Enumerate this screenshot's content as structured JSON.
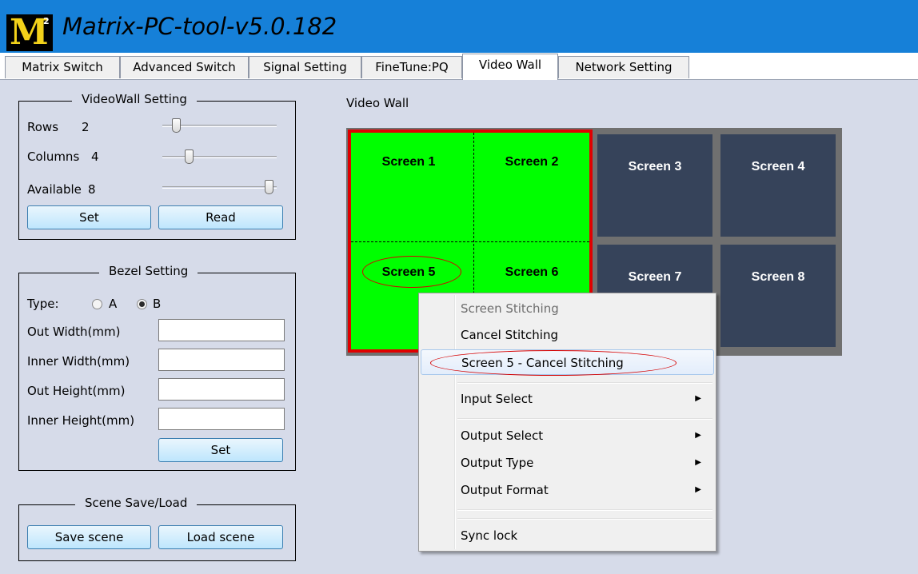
{
  "app": {
    "title": "Matrix-PC-tool-v5.0.182",
    "logo_text": "M",
    "logo_sup": "2"
  },
  "tabs": [
    {
      "label": "Matrix Switch"
    },
    {
      "label": "Advanced Switch"
    },
    {
      "label": "Signal Setting"
    },
    {
      "label": "FineTune:PQ"
    },
    {
      "label": "Video Wall"
    },
    {
      "label": "Network Setting"
    }
  ],
  "active_tab": "Video Wall",
  "videowall_setting": {
    "title": "VideoWall Setting",
    "rows_label": "Rows",
    "rows_value": "2",
    "columns_label": "Columns",
    "columns_value": "4",
    "available_label": "Available",
    "available_value": "8",
    "set_label": "Set",
    "read_label": "Read"
  },
  "bezel_setting": {
    "title": "Bezel Setting",
    "type_label": "Type:",
    "option_a": "A",
    "option_b": "B",
    "selected": "B",
    "out_width_label": "Out Width(mm)",
    "inner_width_label": "Inner Width(mm)",
    "out_height_label": "Out Height(mm)",
    "inner_height_label": "Inner Height(mm)",
    "out_width_value": "",
    "inner_width_value": "",
    "out_height_value": "",
    "inner_height_value": "",
    "set_label": "Set"
  },
  "scene": {
    "title": "Scene Save/Load",
    "save_label": "Save scene",
    "load_label": "Load scene"
  },
  "video_wall": {
    "title": "Video Wall",
    "screens": [
      "Screen 1",
      "Screen 2",
      "Screen 3",
      "Screen 4",
      "Screen 5",
      "Screen 6",
      "Screen 7",
      "Screen 8"
    ],
    "merged_color": "#00ff00",
    "merged_border": "#e00000",
    "screen_color": "#36435a"
  },
  "context_menu": {
    "items": [
      {
        "label": "Screen Stitching",
        "disabled": true
      },
      {
        "label": "Cancel Stitching"
      },
      {
        "label": "Screen 5 - Cancel Stitching",
        "highlighted": true
      },
      {
        "label": "Input Select",
        "submenu": true
      },
      {
        "label": "Output Select",
        "submenu": true
      },
      {
        "label": "Output Type",
        "submenu": true
      },
      {
        "label": "Output Format",
        "submenu": true
      },
      {
        "label": "Sync lock"
      }
    ]
  }
}
